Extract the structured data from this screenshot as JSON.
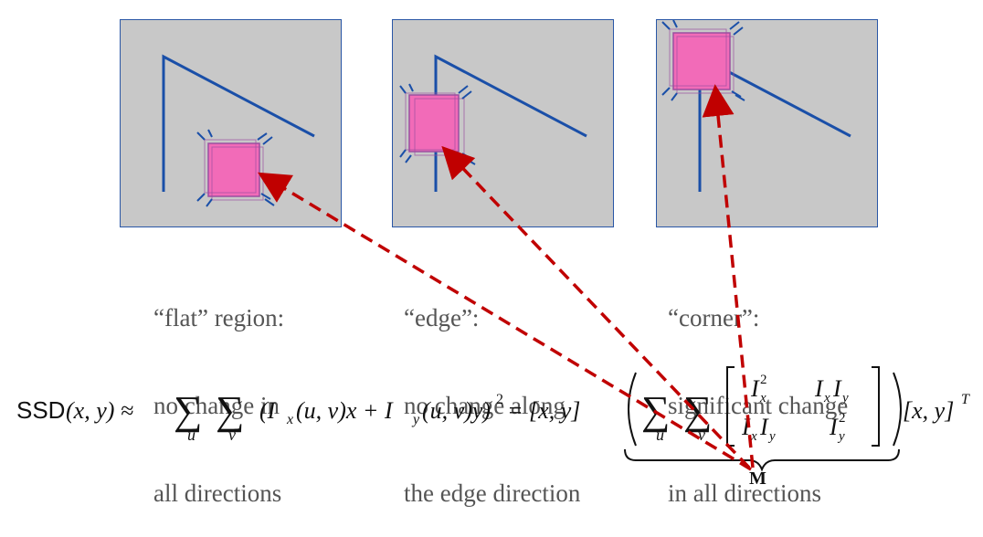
{
  "panels": [
    {
      "id": "flat",
      "caption_lines": [
        "“flat” region:",
        "no change in",
        "all directions"
      ]
    },
    {
      "id": "edge",
      "caption_lines": [
        "“edge”:",
        "no change along",
        "the edge direction"
      ]
    },
    {
      "id": "corner",
      "caption_lines": [
        "“corner”:",
        "significant change",
        "in all directions"
      ]
    }
  ],
  "formula": {
    "ssd_label": "SSD",
    "ssd_args": "(x, y) ≈",
    "sum_u": "∑",
    "sum_v": "∑",
    "index_u": "u",
    "index_v": "v",
    "term": "(I",
    "sub_x": "x",
    "term2": "(u, v)x + I",
    "sub_y": "y",
    "term3": "(u, v)y)",
    "sq": "2",
    "eq": "= [x, y]",
    "matrix_a": "I",
    "matrix_a_sub": "x",
    "matrix_a_sup": "2",
    "matrix_b": "I",
    "matrix_b_sub1": "x",
    "matrix_b_2": "I",
    "matrix_b_sub2": "y",
    "matrix_c": "I",
    "matrix_c_sub1": "x",
    "matrix_c_2": "I",
    "matrix_c_sub2": "y",
    "matrix_d": "I",
    "matrix_d_sub": "y",
    "matrix_d_sup": "2",
    "tail": "[x, y]",
    "tail_sup": "T",
    "brace_label": "M"
  },
  "colors": {
    "line": "#1a4fa8",
    "window_fill": "#f26bb8",
    "arrow": "#c00000",
    "panel_bg": "#c8c8c8"
  }
}
